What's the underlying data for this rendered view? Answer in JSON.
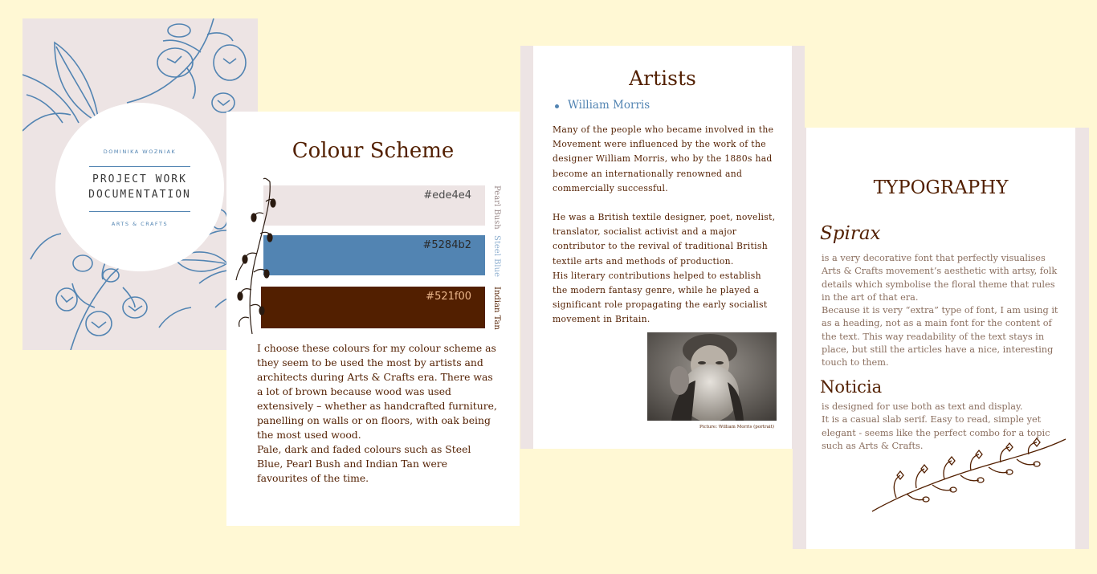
{
  "cover": {
    "author": "DOMINIKA WOZNIAK",
    "title_line1": "PROJECT WORK",
    "title_line2": "DOCUMENTATION",
    "subtitle": "ARTS & CRAFTS",
    "accent_color": "#5284b2",
    "background_color": "#ede4e4"
  },
  "colour_scheme": {
    "heading": "Colour Scheme",
    "swatches": [
      {
        "hex": "#ede4e4",
        "name": "Pearl Bush"
      },
      {
        "hex": "#5284b2",
        "name": "Steel Blue"
      },
      {
        "hex": "#521f00",
        "name": "Indian Tan"
      }
    ],
    "paragraph1": "I choose these colours for my colour scheme as they seem to be used the most by artists and architects during Arts & Crafts era. There was a lot of brown because wood was used extensively – whether as handcrafted furniture, panelling on walls or on floors, with oak being the most used wood.",
    "paragraph2": "Pale, dark and faded colours such as Steel Blue, Pearl Bush and Indian Tan were favourites of the time."
  },
  "artists": {
    "heading": "Artists",
    "bullet": "William Morris",
    "paragraph1": "Many of the people who became involved in the Movement were influenced by the work of the designer William Morris, who by the 1880s had become an internationally renowned and commercially successful.",
    "paragraph2": "He was a British textile designer, poet, novelist, translator, socialist activist and a major contributor to the revival of traditional British textile arts and methods of production.",
    "paragraph3": "His literary contributions helped to establish the modern fantasy genre, while he played a significant role propagating the early socialist movement in Britain.",
    "caption": "Picture: William Morris (portrait)"
  },
  "typography": {
    "heading": "TYPOGRAPHY",
    "font1_name": "Spirax",
    "font1_p1": "is a very decorative font that perfectly visualises Arts & Crafts movement’s aesthetic with artsy, folk details which symbolise the floral theme that rules in the art of that era.",
    "font1_p2": "Because it is very “extra” type of font, I am using it as a heading, not as a main font for the content of the text. This way readability of the text stays in place, but still the articles have a nice, interesting touch to them.",
    "font2_name": "Noticia",
    "font2_p1": "is designed for use both as text and display.",
    "font2_p2": "It is a casual slab serif. Easy to read, simple yet elegant - seems like the perfect combo for a topic such as Arts & Crafts."
  }
}
